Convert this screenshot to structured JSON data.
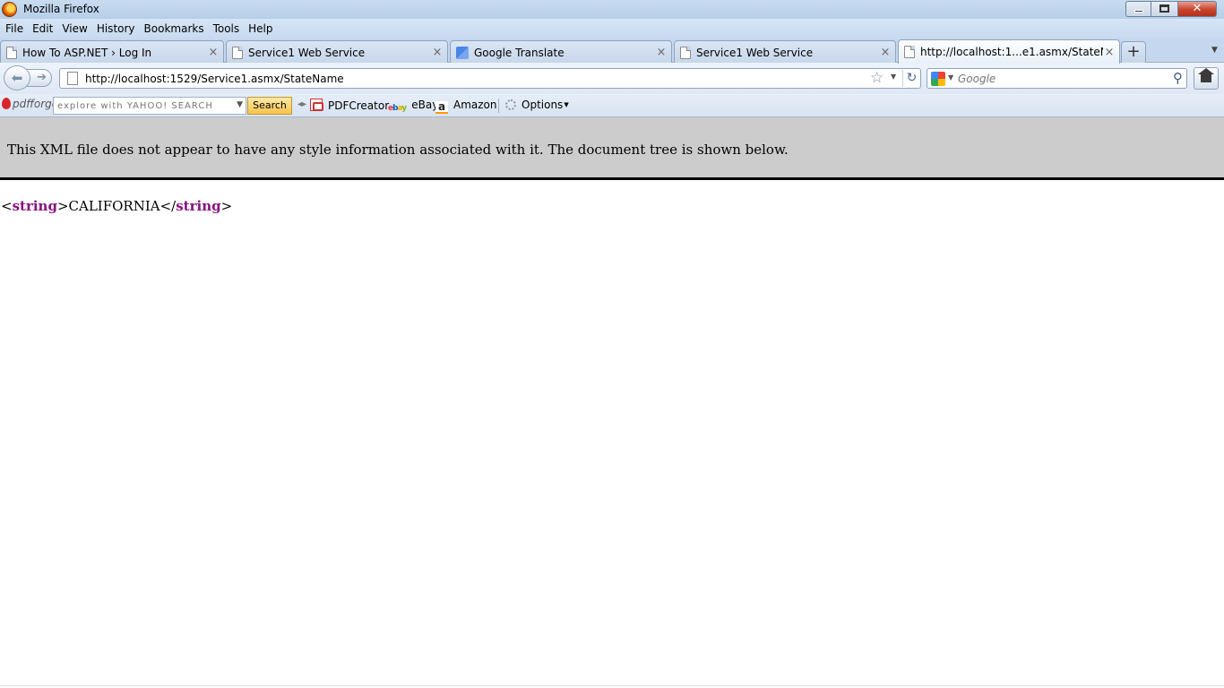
{
  "window": {
    "title": "Mozilla Firefox",
    "close_glyph": "✕"
  },
  "menu": [
    "File",
    "Edit",
    "View",
    "History",
    "Bookmarks",
    "Tools",
    "Help"
  ],
  "tabs": [
    {
      "label": "How To ASP.NET › Log In",
      "active": false
    },
    {
      "label": "Service1 Web Service",
      "active": false
    },
    {
      "label": "Google Translate",
      "active": false
    },
    {
      "label": "Service1 Web Service",
      "active": false
    },
    {
      "label": "http://localhost:1...e1.asmx/StateName",
      "active": true
    }
  ],
  "tab_close_glyph": "×",
  "new_tab_glyph": "+",
  "navbar": {
    "url": "http://localhost:1529/Service1.asmx/StateName",
    "search_placeholder": "Google"
  },
  "pdfforge_toolbar": {
    "brand": "pdfforge",
    "yahoo_placeholder": "explore with YAHOO! SEARCH",
    "search_button": "Search",
    "links": [
      {
        "label": "PDFCreator",
        "icon": "pdf-icon"
      },
      {
        "label": "eBay",
        "icon": "ebay-icon"
      },
      {
        "label": "Amazon",
        "icon": "amazon-icon"
      },
      {
        "label": "Options",
        "icon": "options-icon"
      }
    ]
  },
  "content": {
    "xml_notice": "This XML file does not appear to have any style information associated with it. The document tree is shown below.",
    "xml_open_tag": "string",
    "xml_value": "CALIFORNIA",
    "xml_close_tag": "string"
  },
  "colors": {
    "xml_tag": "#881280",
    "banner_bg": "#cccccc",
    "chrome_bg": "#c4d7ee"
  }
}
